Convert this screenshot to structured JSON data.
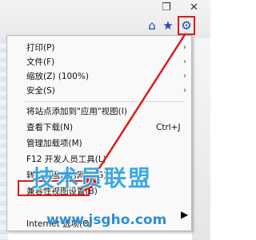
{
  "toolbar": {
    "restore_glyph": "❐",
    "close_glyph": "✕",
    "home_glyph": "⌂",
    "favorites_glyph": "★",
    "tools_glyph": "⚙",
    "highlight_color": "#e01a1a"
  },
  "menu": {
    "items": [
      {
        "label": "打印(P)",
        "submenu": true
      },
      {
        "label": "文件(F)",
        "submenu": true
      },
      {
        "label": "缩放(Z) (100%)",
        "submenu": true
      },
      {
        "label": "安全(S)",
        "submenu": true
      },
      {
        "label": "将站点添加到\"应用\"视图(I)"
      },
      {
        "label": "查看下载(N)",
        "shortcut": "Ctrl+J"
      },
      {
        "label": "管理加载项(M)"
      },
      {
        "label": "F12 开发人员工具(L)"
      },
      {
        "label": "转到已固定的网站(G)"
      },
      {
        "label": "兼容性视图设置(B)"
      },
      {
        "label": "Internet 选项(O)"
      }
    ],
    "submenu_glyph": "›"
  },
  "watermark": {
    "text": "技术员联盟",
    "url": "www.jsgho.com"
  }
}
